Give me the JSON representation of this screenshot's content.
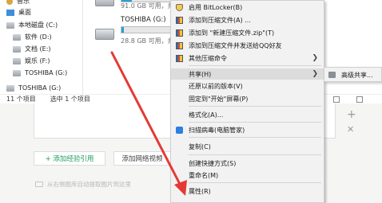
{
  "explorer": {
    "nav_items": [
      {
        "label": "音乐",
        "icon": "music-icon"
      },
      {
        "label": "桌面",
        "icon": "desktop-icon"
      },
      {
        "label": "本地磁盘 (C:)",
        "icon": "drive-icon"
      },
      {
        "label": "软件 (D:)",
        "icon": "drive-icon"
      },
      {
        "label": "文档 (E:)",
        "icon": "drive-icon"
      },
      {
        "label": "娱乐 (F:)",
        "icon": "drive-icon"
      },
      {
        "label": "TOSHIBA (G:)",
        "icon": "drive-icon"
      },
      {
        "label": "TOSHIBA (G:)",
        "icon": "drive-icon"
      }
    ],
    "drives": [
      {
        "name": "",
        "free_text": "91.0 GB 可用，共",
        "used_fraction": 0.2
      },
      {
        "name": "TOSHIBA (G:)",
        "free_text": "28.8 GB 可用，共",
        "used_fraction": 0.05
      }
    ],
    "status": {
      "count": "11 个项目",
      "selected": "选中 1 个项目"
    }
  },
  "context_menu": {
    "items": [
      {
        "label": "启用 BitLocker(B)",
        "icon": "shield-icon"
      },
      {
        "label": "添加到压缩文件(A) ...",
        "icon": "winrar-icon"
      },
      {
        "label": "添加到 \"新建压缩文件.zip\"(T)",
        "icon": "winrar-icon"
      },
      {
        "label": "添加到压缩文件并发送给QQ好友",
        "icon": "winrar-icon"
      },
      {
        "label": "其他压缩命令",
        "icon": "winrar-icon"
      },
      {
        "label": "共享(H)"
      },
      {
        "label": "还原以前的版本(V)"
      },
      {
        "label": "固定到\"开始\"屏幕(P)"
      },
      {
        "label": "格式化(A)..."
      },
      {
        "label": "扫描病毒(电脑管家)",
        "icon": "tencent-pc-manager-icon"
      },
      {
        "label": "复制(C)"
      },
      {
        "label": "创建快捷方式(S)"
      },
      {
        "label": "重命名(M)"
      },
      {
        "label": "属性(R)"
      }
    ],
    "submenu": {
      "label": "高级共享..."
    }
  },
  "webpage": {
    "add_citation": "+ 添加经验引用",
    "add_video": "添加网络视频",
    "extract_image": "从右侧图库自动提取图片到这里",
    "plus_icon_glyph": "+",
    "close_icon_glyph": "✕"
  },
  "colors": {
    "annotation_arrow": "#e53935",
    "menu_background": "#f2f2f2",
    "menu_highlight": "#dcdcdc",
    "accent_green": "#1e9c58",
    "drive_bar_fill": "#26a0da"
  }
}
